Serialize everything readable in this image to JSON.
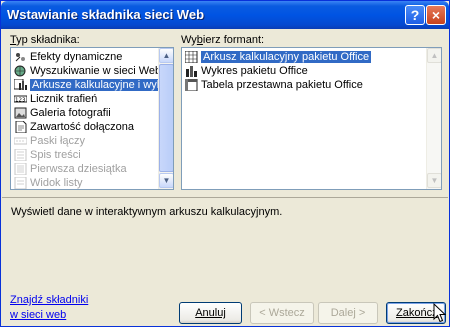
{
  "window": {
    "title": "Wstawianie składnika sieci Web",
    "help_button": "?",
    "close_button": "×"
  },
  "component_type": {
    "label_prefix": "T",
    "label_rest": "yp składnika:",
    "items": [
      {
        "label": "Efekty dynamiczne",
        "icon": "effects-icon",
        "state": "normal"
      },
      {
        "label": "Wyszukiwanie w sieci Web",
        "icon": "web-search-icon",
        "state": "normal"
      },
      {
        "label": "Arkusze kalkulacyjne i wykres",
        "icon": "spreadsheet-chart-icon",
        "state": "selected"
      },
      {
        "label": "Licznik trafień",
        "icon": "hit-counter-icon",
        "state": "normal"
      },
      {
        "label": "Galeria fotografii",
        "icon": "photo-gallery-icon",
        "state": "normal"
      },
      {
        "label": "Zawartość dołączona",
        "icon": "included-content-icon",
        "state": "normal"
      },
      {
        "label": "Paski łączy",
        "icon": "link-bars-icon",
        "state": "disabled"
      },
      {
        "label": "Spis treści",
        "icon": "table-of-contents-icon",
        "state": "disabled"
      },
      {
        "label": "Pierwsza dziesiątka",
        "icon": "top-ten-icon",
        "state": "disabled"
      },
      {
        "label": "Widok listy",
        "icon": "list-view-icon",
        "state": "disabled"
      }
    ]
  },
  "format": {
    "label_prefix": "Wy",
    "label_underlined": "b",
    "label_rest": "ierz formant:",
    "items": [
      {
        "label": "Arkusz kalkulacyjny pakietu Office",
        "icon": "office-spreadsheet-icon",
        "state": "selected"
      },
      {
        "label": "Wykres pakietu Office",
        "icon": "office-chart-icon",
        "state": "normal"
      },
      {
        "label": "Tabela przestawna pakietu Office",
        "icon": "office-pivot-table-icon",
        "state": "normal"
      }
    ]
  },
  "description": "Wyświetl dane w interaktywnym arkuszu kalkulacyjnym.",
  "find_components": {
    "line1": "Znajdź składniki",
    "line2": "w sieci web"
  },
  "buttons": {
    "cancel": "Anuluj",
    "back": "< Wstecz",
    "next": "Dalej >",
    "finish": "Zakończ"
  },
  "colors": {
    "selection": "#316ac5",
    "titlebar": "#0054e3",
    "link": "#0000ee"
  }
}
